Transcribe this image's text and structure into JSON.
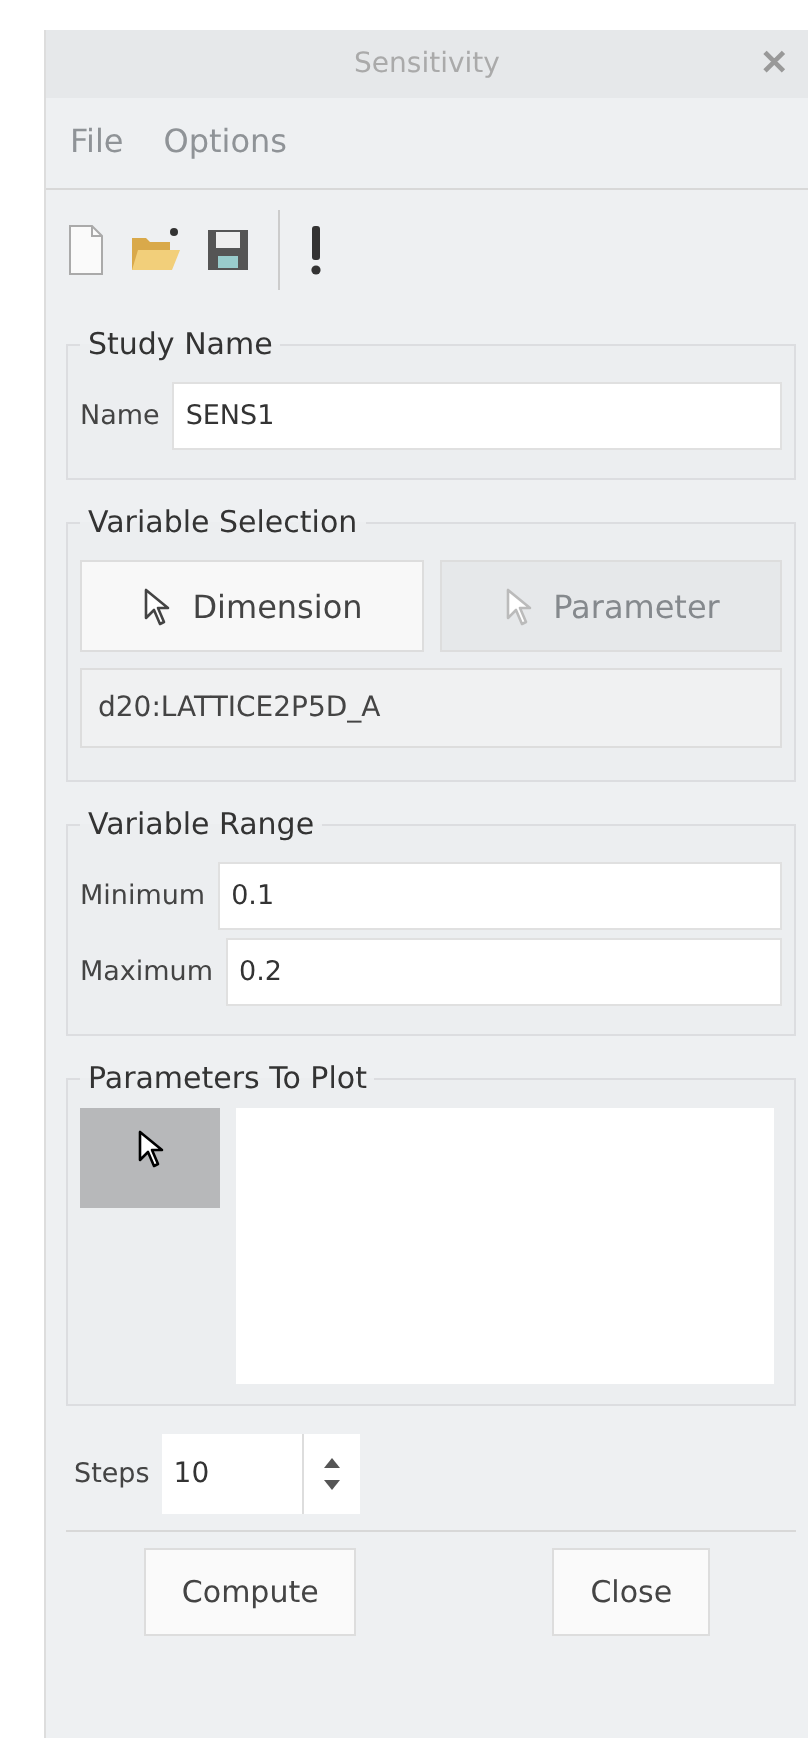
{
  "window": {
    "title": "Sensitivity",
    "close": "✕"
  },
  "menu": [
    {
      "label": "File",
      "disabled": true
    },
    {
      "label": "Options",
      "disabled": true
    }
  ],
  "toolbar": [
    {
      "kind": "new"
    },
    {
      "kind": "open"
    },
    {
      "kind": "save"
    },
    {
      "kind": "separator"
    },
    {
      "kind": "run"
    }
  ],
  "study_name": {
    "title": "Study Name",
    "label": "Name",
    "value": "SENS1"
  },
  "variable_selection": {
    "title": "Variable Selection",
    "buttons": [
      {
        "label": "Dimension",
        "disabled": false
      },
      {
        "label": "Parameter",
        "disabled": true
      }
    ],
    "value": "d20:LATTICE2P5D_A"
  },
  "variable_range": {
    "title": "Variable Range",
    "fields": [
      {
        "label": "Minimum",
        "value": "0.1"
      },
      {
        "label": "Maximum",
        "value": "0.2"
      }
    ]
  },
  "parameters_to_plot": {
    "title": "Parameters To Plot",
    "selector_active": true
  },
  "steps": {
    "label": "Steps",
    "value": "10"
  },
  "buttons": [
    "Compute",
    "Close"
  ]
}
